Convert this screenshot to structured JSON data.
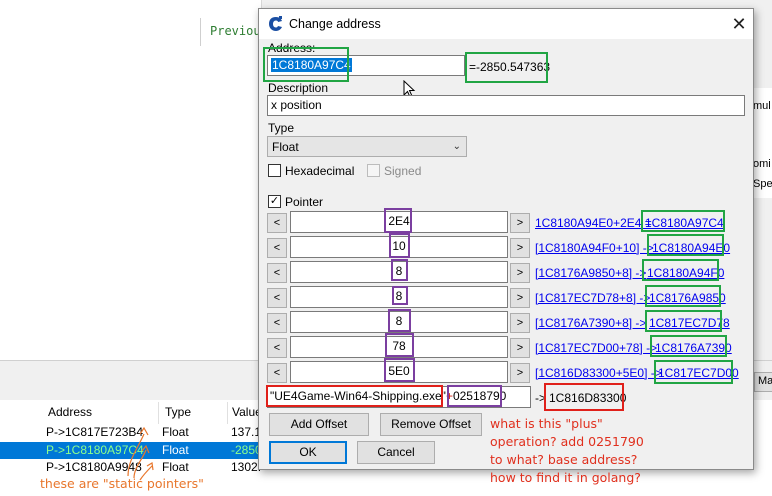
{
  "background": {
    "previous_label": "Previous",
    "right_fragments": [
      "mul",
      "omi",
      "Spe"
    ],
    "mini_button": "Ma",
    "columns": [
      "Address",
      "Type",
      "Value"
    ],
    "rows": [
      {
        "address": "P->1C817E723B4",
        "type": "Float",
        "value": "137.1"
      },
      {
        "address": "P->1C8180A97C4",
        "type": "Float",
        "value": "-2850"
      },
      {
        "address": "P->1C8180A9948",
        "type": "Float",
        "value": "1302."
      }
    ]
  },
  "dialog": {
    "title": "Change address",
    "address_label": "Address:",
    "address_value": "1C8180A97C4",
    "address_result": "=-2850.547363",
    "description_label": "Description",
    "description_value": "x position",
    "type_label": "Type",
    "type_value": "Float",
    "hexadecimal_label": "Hexadecimal",
    "signed_label": "Signed",
    "pointer_label": "Pointer",
    "pointer_checked": true,
    "prev_button": "<",
    "next_button": ">",
    "offsets": [
      {
        "value": "2E4",
        "expr": "1C8180A94E0+2E4 =",
        "result": "1C8180A97C4"
      },
      {
        "value": "10",
        "expr": "[1C8180A94F0+10] ->",
        "result": "1C8180A94E0"
      },
      {
        "value": "8",
        "expr": "[1C8176A9850+8] ->",
        "result": "1C8180A94F0"
      },
      {
        "value": "8",
        "expr": "[1C817EC7D78+8] ->",
        "result": "1C8176A9850"
      },
      {
        "value": "8",
        "expr": "[1C8176A7390+8] ->",
        "result": "1C817EC7D78"
      },
      {
        "value": "78",
        "expr": "[1C817EC7D00+78] ->",
        "result": "1C8176A7390"
      },
      {
        "value": "5E0",
        "expr": "[1C816D83300+5E0] ->",
        "result": "1C817EC7D00"
      }
    ],
    "base_module": "\"UE4Game-Win64-Shipping.exe\"",
    "base_plus": "+",
    "base_offset": "02518790",
    "base_arrow": "->",
    "base_result": "1C816D83300",
    "add_offset_button": "Add Offset",
    "remove_offset_button": "Remove Offset",
    "ok_button": "OK",
    "cancel_button": "Cancel"
  },
  "annotations": {
    "question_lines": [
      "what is this \"plus\"",
      "operation? add 0251790",
      "to what? base address?",
      "how to find it in golang?"
    ],
    "static_pointers_note": "these are \"static pointers\""
  },
  "colors": {
    "green_box": "#21a544",
    "purple_box": "#7b3fa0",
    "red_box": "#e0201a",
    "annotation_text": "#e0301e",
    "selection_blue": "#0078d7",
    "link_blue": "#0000ee"
  }
}
